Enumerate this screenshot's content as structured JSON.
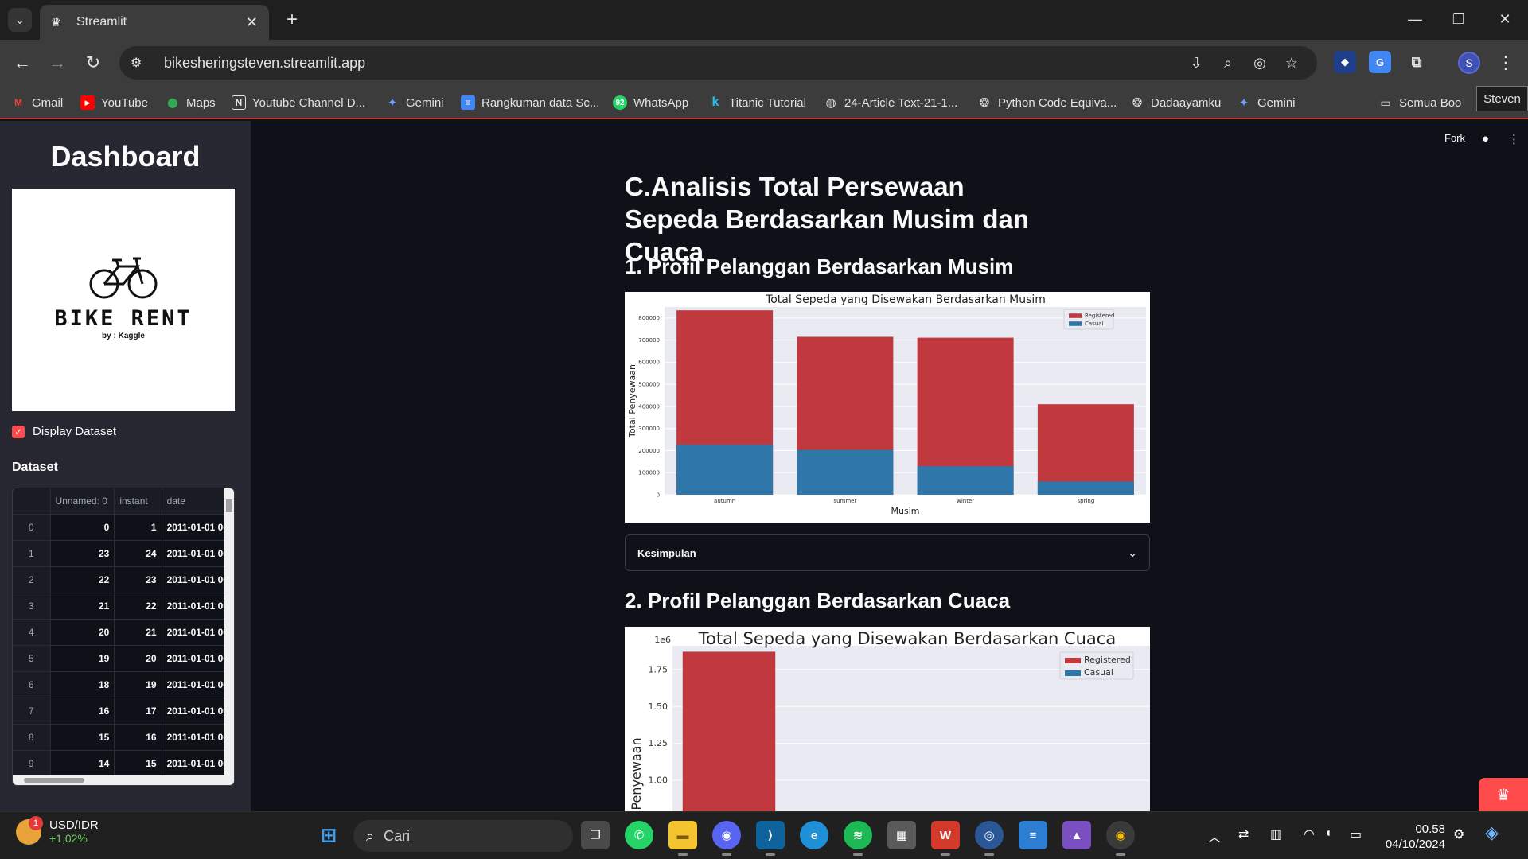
{
  "browser": {
    "tab_title": "Streamlit",
    "url": "bikesheringsteven.streamlit.app",
    "tooltip": "Steven",
    "profile_initial": "S",
    "bookmarks": [
      {
        "label": "Gmail",
        "icon": "gmail-icon"
      },
      {
        "label": "YouTube",
        "icon": "youtube-icon"
      },
      {
        "label": "Maps",
        "icon": "maps-icon"
      },
      {
        "label": "Youtube Channel D...",
        "icon": "page-icon"
      },
      {
        "label": "Gemini",
        "icon": "gemini-icon"
      },
      {
        "label": "Rangkuman data Sc...",
        "icon": "docs-icon"
      },
      {
        "label": "WhatsApp",
        "icon": "whatsapp-icon"
      },
      {
        "label": "Titanic Tutorial",
        "icon": "kaggle-icon"
      },
      {
        "label": "24-Article Text-21-1...",
        "icon": "globe-icon"
      },
      {
        "label": "Python Code Equiva...",
        "icon": "chatgpt-icon"
      },
      {
        "label": "Dadaayamku",
        "icon": "chatgpt-icon"
      },
      {
        "label": "Gemini",
        "icon": "gemini-icon"
      },
      {
        "label": "Semua Boo",
        "icon": "folder-icon"
      }
    ]
  },
  "app": {
    "header_fork": "Fork",
    "sidebar": {
      "title": "Dashboard",
      "logo_brand": "BIKE RENT",
      "logo_by": "by : Kaggle",
      "checkbox_label": "Display Dataset",
      "dataset_heading": "Dataset",
      "table": {
        "columns": [
          "",
          "Unnamed: 0",
          "instant",
          "date"
        ],
        "rows": [
          [
            "0",
            "0",
            "1",
            "2011-01-01 00"
          ],
          [
            "1",
            "23",
            "24",
            "2011-01-01 00"
          ],
          [
            "2",
            "22",
            "23",
            "2011-01-01 00"
          ],
          [
            "3",
            "21",
            "22",
            "2011-01-01 00"
          ],
          [
            "4",
            "20",
            "21",
            "2011-01-01 00"
          ],
          [
            "5",
            "19",
            "20",
            "2011-01-01 00"
          ],
          [
            "6",
            "18",
            "19",
            "2011-01-01 00"
          ],
          [
            "7",
            "16",
            "17",
            "2011-01-01 00"
          ],
          [
            "8",
            "15",
            "16",
            "2011-01-01 00"
          ],
          [
            "9",
            "14",
            "15",
            "2011-01-01 00"
          ]
        ]
      }
    },
    "main": {
      "section_title": "C.Analisis Total Persewaan Sepeda Berdasarkan Musim dan Cuaca",
      "sub1": "1. Profil Pelanggan Berdasarkan Musim",
      "expander_label": "Kesimpulan",
      "sub2": "2. Profil Pelanggan Berdasarkan Cuaca"
    }
  },
  "colors": {
    "registered": "#c0393e",
    "casual": "#2f77a9",
    "plot_bg": "#eaeaf2",
    "accent": "#ff4b4b"
  },
  "chart_data": [
    {
      "type": "bar",
      "stacked": true,
      "title": "Total Sepeda yang Disewakan Berdasarkan Musim",
      "xlabel": "Musim",
      "ylabel": "Total Penyewaan",
      "categories": [
        "autumn",
        "summer",
        "winter",
        "spring"
      ],
      "series": [
        {
          "name": "Registered",
          "values": [
            835000,
            715000,
            711000,
            410000
          ]
        },
        {
          "name": "Casual",
          "values": [
            226000,
            203000,
            129000,
            60000
          ]
        }
      ],
      "ylim": [
        0,
        850000
      ],
      "yticks": [
        0,
        100000,
        200000,
        300000,
        400000,
        500000,
        600000,
        700000,
        800000
      ],
      "legend": "top-right",
      "grid": true
    },
    {
      "type": "bar",
      "stacked": true,
      "title": "Total Sepeda yang Disewakan Berdasarkan Cuaca",
      "ylabel": "Penyewaan",
      "offset_label": "1e6",
      "categories": [
        ""
      ],
      "series": [
        {
          "name": "Registered",
          "values": [
            1.87
          ]
        },
        {
          "name": "Casual",
          "values": [
            0
          ]
        }
      ],
      "yticks": [
        1.0,
        1.25,
        1.5,
        1.75
      ],
      "ytick_labels": [
        "1.00",
        "1.25",
        "1.50",
        "1.75"
      ],
      "legend": "top-right",
      "grid": true
    }
  ],
  "taskbar": {
    "ticker_name": "USD/IDR",
    "ticker_change": "+1,02%",
    "ticker_badge": "1",
    "search_placeholder": "Cari",
    "time": "00.58",
    "date": "04/10/2024"
  }
}
